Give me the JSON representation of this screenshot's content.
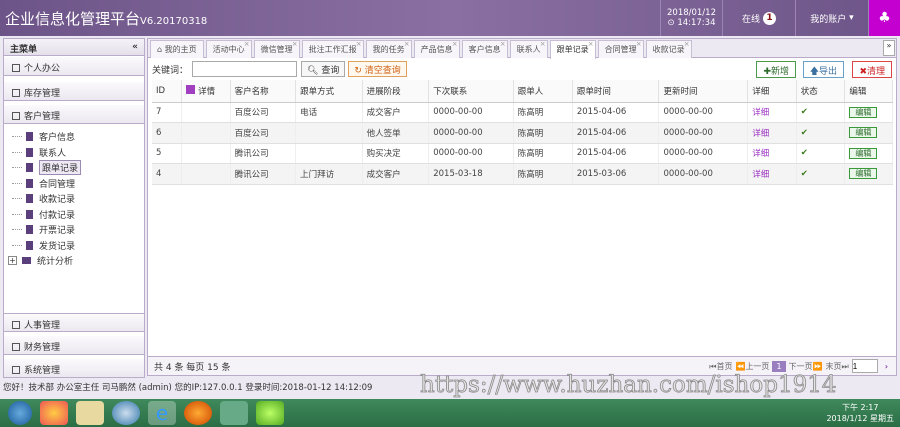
{
  "header": {
    "title": "企业信息化管理平台",
    "version": "V6.20170318",
    "date": "2018/01/12",
    "time": "14:17:34",
    "online_label": "在线",
    "online_count": "1",
    "account_label": "我的账户"
  },
  "sidebar": {
    "title": "主菜单",
    "collapse": "«",
    "sections_top": [
      "个人办公",
      "库存管理",
      "客户管理"
    ],
    "tree": [
      "客户信息",
      "联系人",
      "跟单记录",
      "合同管理",
      "收款记录",
      "付款记录",
      "开票记录",
      "发货记录",
      "统计分析"
    ],
    "sections_bottom": [
      "人事管理",
      "财务管理",
      "系统管理"
    ]
  },
  "tabs": [
    "我的主页",
    "活动中心",
    "微信管理",
    "批注工作汇报",
    "我的任务",
    "产品信息",
    "客户信息",
    "联系人",
    "跟单记录",
    "合同管理",
    "收款记录"
  ],
  "active_tab": "跟单记录",
  "toolbar": {
    "keyword_label": "关键词：",
    "keyword_value": "",
    "search": "查询",
    "clear": "清空查询",
    "add": "新增",
    "export": "导出",
    "clean": "清理"
  },
  "table": {
    "headers": [
      "ID",
      "详情",
      "客户名称",
      "跟单方式",
      "进展阶段",
      "下次联系",
      "跟单人",
      "跟单时间",
      "更新时间",
      "详细",
      "状态",
      "编辑"
    ],
    "rows": [
      [
        "7",
        "",
        "百度公司",
        "电话",
        "成交客户",
        "0000-00-00",
        "陈高明",
        "2015-04-06",
        "0000-00-00",
        "详细",
        "✔",
        "编辑"
      ],
      [
        "6",
        "",
        "百度公司",
        "",
        "他人签单",
        "0000-00-00",
        "陈高明",
        "2015-04-06",
        "0000-00-00",
        "详细",
        "✔",
        "编辑"
      ],
      [
        "5",
        "",
        "腾讯公司",
        "",
        "购买决定",
        "0000-00-00",
        "陈高明",
        "2015-04-06",
        "0000-00-00",
        "详细",
        "✔",
        "编辑"
      ],
      [
        "4",
        "",
        "腾讯公司",
        "上门拜访",
        "成交客户",
        "2015-03-18",
        "陈高明",
        "2015-03-06",
        "0000-00-00",
        "详细",
        "✔",
        "编辑"
      ]
    ]
  },
  "footer": {
    "summary": "共 4 条 每页 15 条",
    "first": "首页",
    "prev": "上一页",
    "page": "1",
    "next": "下一页",
    "last": "末页",
    "page_input": "1"
  },
  "status": "您好！技术部 办公室主任 司马鹏然 (admin) 您的IP:127.0.0.1 登录时间:2018-01-12 14:12:09",
  "watermark": "https://www.huzhan.com/ishop1914",
  "taskbar": {
    "time": "下午 2:17",
    "date": "2018/1/12 星期五"
  }
}
